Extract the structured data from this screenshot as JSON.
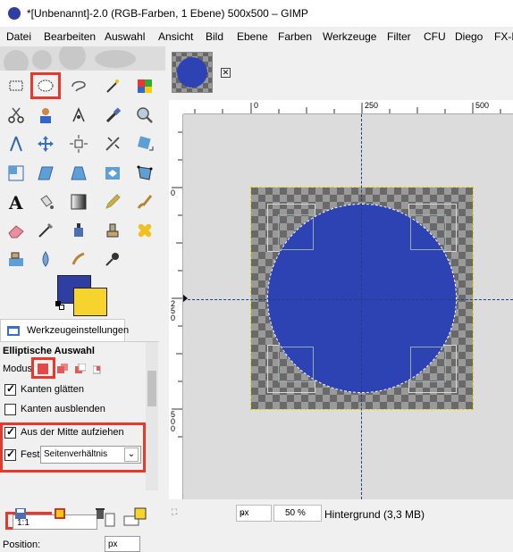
{
  "window": {
    "title": "*[Unbenannt]-2.0 (RGB-Farben, 1 Ebene) 500x500 – GIMP"
  },
  "menu": [
    "Datei",
    "Bearbeiten",
    "Auswahl",
    "Ansicht",
    "Bild",
    "Ebene",
    "Farben",
    "Werkzeuge",
    "Filter",
    "CFU",
    "Diego",
    "FX-F"
  ],
  "toolbox": {
    "tools": [
      "rect-select",
      "ellipse-select",
      "free-select",
      "fuzzy-select",
      "select-by-color",
      "scissors-select",
      "foreground-select",
      "paths",
      "color-picker",
      "zoom",
      "measure",
      "move",
      "align",
      "crop",
      "rotate",
      "scale",
      "shear",
      "perspective",
      "flip",
      "cage-transform",
      "text",
      "bucket-fill",
      "blend",
      "pencil",
      "paintbrush",
      "eraser",
      "airbrush",
      "ink",
      "clone",
      "heal",
      "perspective-clone",
      "blur",
      "smudge",
      "dodge-burn"
    ],
    "fg_color": "#2e3ea3",
    "bg_color": "#f6d32d"
  },
  "tool_options": {
    "tab_label": "Werkzeugeinstellungen",
    "title": "Elliptische Auswahl",
    "mode_label": "Modus:",
    "antialias_label": "Kanten glätten",
    "feather_label": "Kanten ausblenden",
    "expand_center_label": "Aus der Mitte aufziehen",
    "fixed_label": "Fest:",
    "fixed_value": "Seitenverhältnis",
    "ratio_value": "1:1",
    "position_label": "Position:",
    "unit": "px"
  },
  "image_tab": {
    "close": "✕"
  },
  "rulers": {
    "horizontal": [
      "0",
      "250",
      "500"
    ],
    "vertical": [
      "0",
      "250",
      "500"
    ]
  },
  "status": {
    "unit": "px",
    "zoom": "50 %",
    "layer": "Hintergrund (3,3 MB)"
  },
  "colors": {
    "accent_highlight": "#e8372b",
    "circle": "#2e43b3"
  }
}
